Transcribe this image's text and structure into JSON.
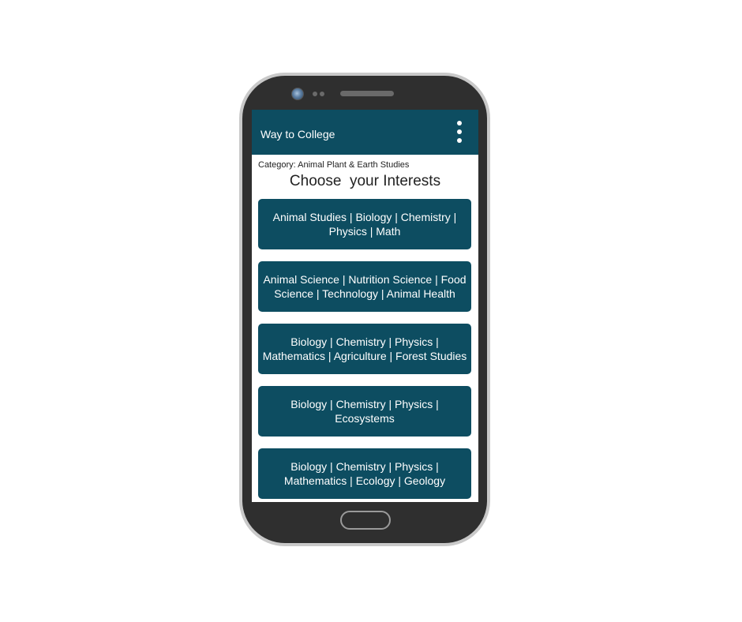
{
  "app": {
    "title": "Way to College",
    "menu_icon": "more-vert-icon"
  },
  "page": {
    "category": "Category: Animal Plant & Earth Studies",
    "heading": "Choose  your Interests"
  },
  "interests": [
    {
      "label": "Animal Studies | Biology | Chemistry | Physics | Math"
    },
    {
      "label": "Animal Science | Nutrition Science | Food Science | Technology | Animal Health"
    },
    {
      "label": "Biology | Chemistry | Physics | Mathematics | Agriculture | Forest Studies"
    },
    {
      "label": "Biology | Chemistry | Physics | Ecosystems"
    },
    {
      "label": "Biology | Chemistry | Physics | Mathematics | Ecology | Geology"
    }
  ],
  "colors": {
    "accent": "#0d4d61",
    "phone_body": "#2f2f2f",
    "phone_frame": "#c9c9c9"
  }
}
